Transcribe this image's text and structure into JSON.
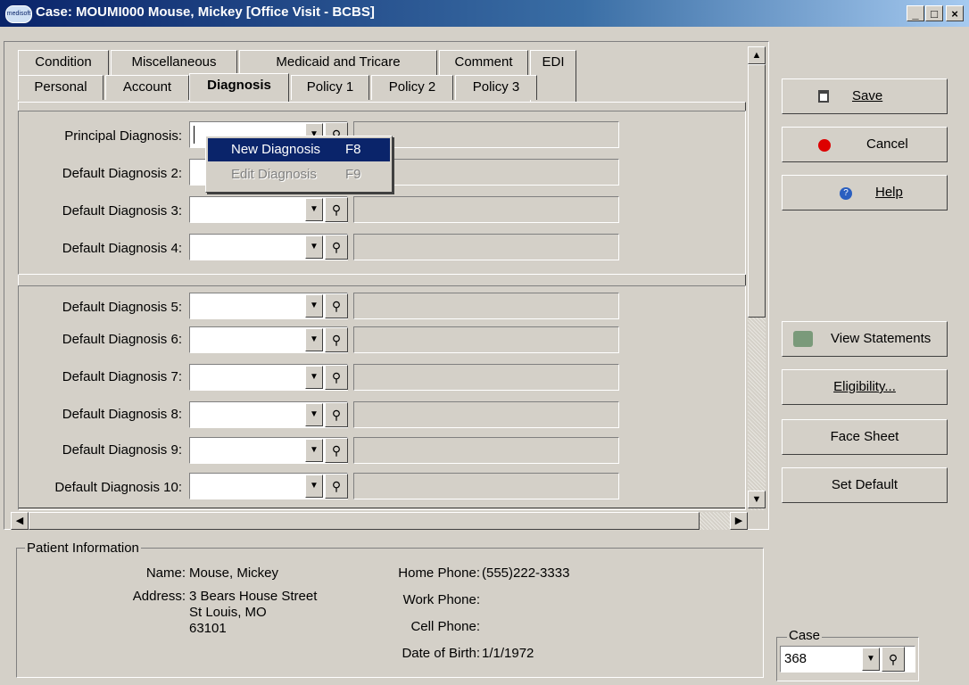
{
  "window": {
    "title": "Case: MOUMI000 Mouse, Mickey  [Office Visit - BCBS]",
    "app_icon_text": "medisoft",
    "minimize": "_",
    "maximize": "□",
    "close": "×"
  },
  "tabs": {
    "row1": [
      {
        "label": "Condition"
      },
      {
        "label": "Miscellaneous"
      },
      {
        "label": "Medicaid and Tricare"
      },
      {
        "label": "Comment"
      },
      {
        "label": "EDI"
      }
    ],
    "row2": [
      {
        "label": "Personal"
      },
      {
        "label": "Account"
      },
      {
        "label": "Diagnosis"
      },
      {
        "label": "Policy 1"
      },
      {
        "label": "Policy 2"
      },
      {
        "label": "Policy 3"
      }
    ]
  },
  "diagnosis": {
    "rows": [
      {
        "label": "Principal Diagnosis:",
        "value": ""
      },
      {
        "label": "Default Diagnosis 2:",
        "value": ""
      },
      {
        "label": "Default Diagnosis 3:",
        "value": ""
      },
      {
        "label": "Default Diagnosis 4:",
        "value": ""
      },
      {
        "label": "Default Diagnosis 5:",
        "value": ""
      },
      {
        "label": "Default Diagnosis 6:",
        "value": ""
      },
      {
        "label": "Default Diagnosis 7:",
        "value": ""
      },
      {
        "label": "Default Diagnosis 8:",
        "value": ""
      },
      {
        "label": "Default Diagnosis 9:",
        "value": ""
      },
      {
        "label": "Default Diagnosis 10:",
        "value": ""
      }
    ]
  },
  "context_menu": {
    "items": [
      {
        "label": "New Diagnosis",
        "shortcut": "F8",
        "highlighted": true,
        "enabled": true
      },
      {
        "label": "Edit Diagnosis",
        "shortcut": "F9",
        "highlighted": false,
        "enabled": false
      }
    ]
  },
  "buttons": {
    "save": "Save",
    "cancel": "Cancel",
    "help": "Help",
    "view_statements": "View Statements",
    "eligibility": "Eligibility...",
    "face_sheet": "Face Sheet",
    "set_default": "Set Default"
  },
  "patient_info": {
    "title": "Patient Information",
    "name_label": "Name:",
    "name": "Mouse, Mickey",
    "address_label": "Address:",
    "address_line1": "3 Bears House Street",
    "address_line2": "St Louis, MO",
    "address_line3": "63101",
    "home_phone_label": "Home Phone:",
    "home_phone": "(555)222-3333",
    "work_phone_label": "Work Phone:",
    "work_phone": "",
    "cell_phone_label": "Cell Phone:",
    "cell_phone": "",
    "dob_label": "Date of Birth:",
    "dob": "1/1/1972"
  },
  "case": {
    "label": "Case",
    "value": "368"
  },
  "icons": {
    "dropdown": "▼",
    "lookup": "⚲",
    "scroll_up": "▲",
    "scroll_down": "▼",
    "scroll_left": "◀",
    "scroll_right": "▶"
  },
  "colors": {
    "title_bar": "#0a246a",
    "menu_highlight": "#0a246a",
    "face": "#d4d0c8"
  }
}
